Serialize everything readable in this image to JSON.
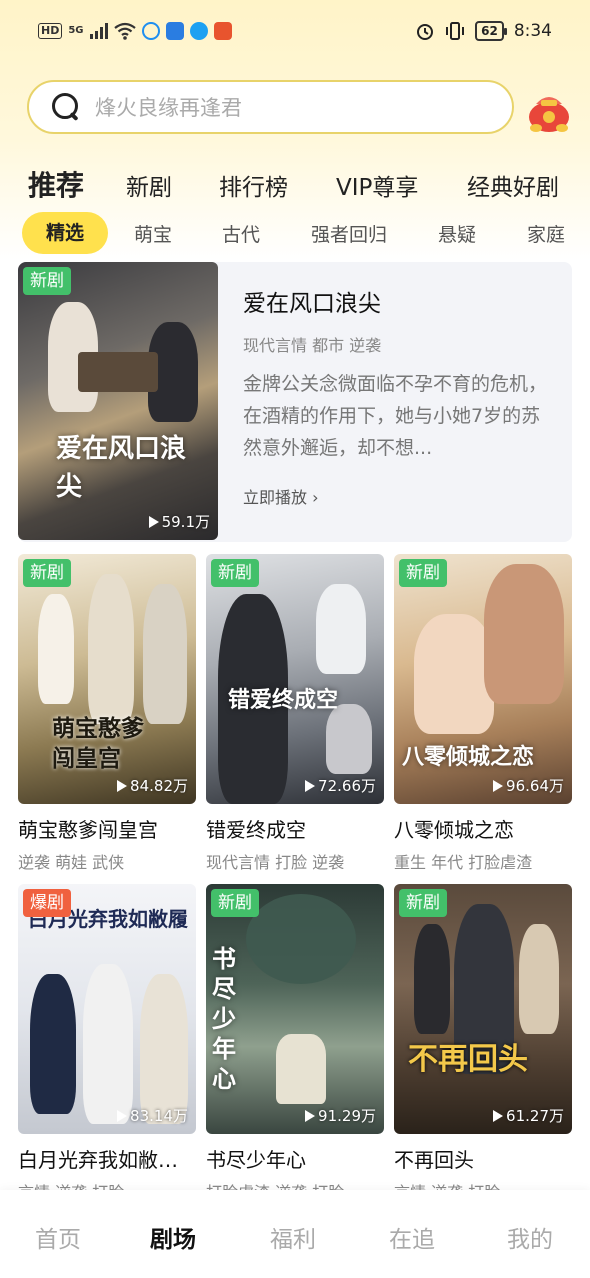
{
  "status_bar": {
    "hd": "HD",
    "net": "5G",
    "battery": "62",
    "time": "8:34"
  },
  "search": {
    "placeholder": "烽火良缘再逢君"
  },
  "main_tabs": [
    "推荐",
    "新剧",
    "排行榜",
    "VIP尊享",
    "经典好剧"
  ],
  "sub_tabs": [
    "精选",
    "萌宝",
    "古代",
    "强者回归",
    "悬疑",
    "家庭"
  ],
  "featured": {
    "badge": "新剧",
    "poster_art": "爱在风口浪尖",
    "views": "59.1万",
    "title": "爱在风口浪尖",
    "tags": "现代言情 都市 逆袭",
    "description": "金牌公关念微面临不孕不育的危机，在酒精的作用下，她与小她7岁的苏然意外邂逅，却不想...",
    "play_label": "立即播放"
  },
  "cards": [
    {
      "badge": "新剧",
      "art": "萌宝憨爹闯皇宫",
      "views": "84.82万",
      "title": "萌宝憨爹闯皇宫",
      "tags": "逆袭 萌娃 武侠"
    },
    {
      "badge": "新剧",
      "art": "错爱终成空",
      "views": "72.66万",
      "title": "错爱终成空",
      "tags": "现代言情 打脸 逆袭"
    },
    {
      "badge": "新剧",
      "art": "八零倾城之恋",
      "views": "96.64万",
      "title": "八零倾城之恋",
      "tags": "重生 年代 打脸虐渣"
    },
    {
      "badge": "爆剧",
      "art": "白月光弃我如敝履",
      "views": "83.14万",
      "title": "白月光弃我如敝…",
      "tags": "言情 逆袭 打脸"
    },
    {
      "badge": "新剧",
      "art": "书尽少年心",
      "views": "91.29万",
      "title": "书尽少年心",
      "tags": "打脸虐渣 逆袭 打脸"
    },
    {
      "badge": "新剧",
      "art": "不再回头",
      "views": "61.27万",
      "title": "不再回头",
      "tags": "言情 逆袭 打脸"
    }
  ],
  "bottom_nav": [
    "首页",
    "剧场",
    "福利",
    "在追",
    "我的"
  ],
  "colors": {
    "accent_yellow": "#ffe14d",
    "new_badge": "#43c06a",
    "hot_badge": "#f0613f"
  }
}
